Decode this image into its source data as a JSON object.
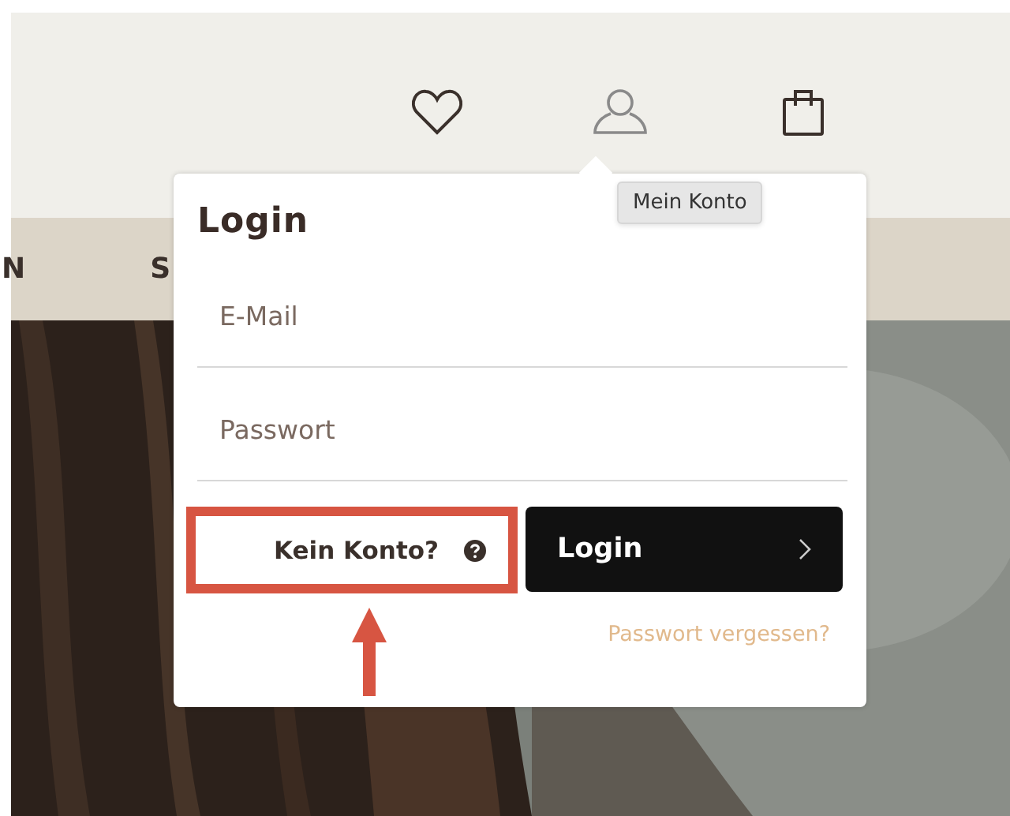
{
  "header_icons": [
    {
      "kind": "heart"
    },
    {
      "kind": "user"
    },
    {
      "kind": "bag"
    }
  ],
  "tooltip": "Mein Konto",
  "nav": [
    "N",
    "S"
  ],
  "login_popup": {
    "title": "Login",
    "fields": [
      {
        "placeholder": "E-Mail"
      },
      {
        "placeholder": "Passwort"
      }
    ],
    "register_button": "Kein Konto?",
    "login_button": "Login",
    "forgot_link": "Passwort vergessen?"
  }
}
